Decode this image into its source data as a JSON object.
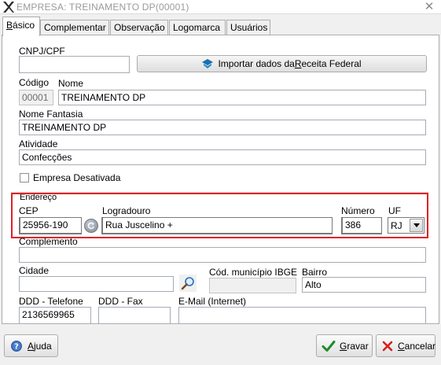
{
  "window": {
    "title": "EMPRESA: TREINAMENTO DP(00001)",
    "close_glyph": "✕"
  },
  "tabs": [
    {
      "label": "Básico",
      "mnemonic": "B",
      "rest": "ásico",
      "active": true
    },
    {
      "label": "Complementar",
      "active": false
    },
    {
      "label": "Observação",
      "active": false
    },
    {
      "label": "Logomarca",
      "active": false
    },
    {
      "label": "Usuários",
      "active": false
    }
  ],
  "basic": {
    "cnpj_label": "CNPJ/CPF",
    "cnpj_value": "",
    "import_button": {
      "pre": "Importar dados da ",
      "mnemonic": "R",
      "post": "eceita Federal",
      "icon": "receita-federal-icon"
    },
    "codigo_label": "Código",
    "codigo_value": "00001",
    "nome_label": "Nome",
    "nome_value": "TREINAMENTO DP",
    "fantasia_label": "Nome Fantasia",
    "fantasia_value": "TREINAMENTO DP",
    "atividade_label": "Atividade",
    "atividade_value": "Confecções",
    "desativada_label": "Empresa Desativada",
    "desativada_checked": false
  },
  "address": {
    "group_label": "Endereço",
    "cep_label": "CEP",
    "cep_value": "25956-190",
    "logradouro_label": "Logradouro",
    "logradouro_value": "Rua Juscelino +",
    "numero_label": "Número",
    "numero_value": "386",
    "uf_label": "UF",
    "uf_value": "RJ",
    "highlight_color": "#e02027"
  },
  "more": {
    "complemento_label": "Complemento",
    "complemento_value": "",
    "cidade_label": "Cidade",
    "cidade_value": "",
    "ibge_label": "Cód. município IBGE",
    "ibge_value": "",
    "bairro_label": "Bairro",
    "bairro_value": "Alto",
    "ddd_tel_label": "DDD - Telefone",
    "ddd_tel_value": "2136569965",
    "ddd_fax_label": "DDD - Fax",
    "ddd_fax_value": "",
    "email_label": "E-Mail (Internet)",
    "email_value": ""
  },
  "footer": {
    "help": {
      "mnemonic": "A",
      "rest": "juda",
      "icon": "help-icon"
    },
    "save": {
      "mnemonic": "G",
      "rest": "ravar",
      "icon": "checkmark-icon"
    },
    "cancel": {
      "mnemonic": "C",
      "rest": "ancelar",
      "icon": "cancel-x-icon"
    }
  }
}
